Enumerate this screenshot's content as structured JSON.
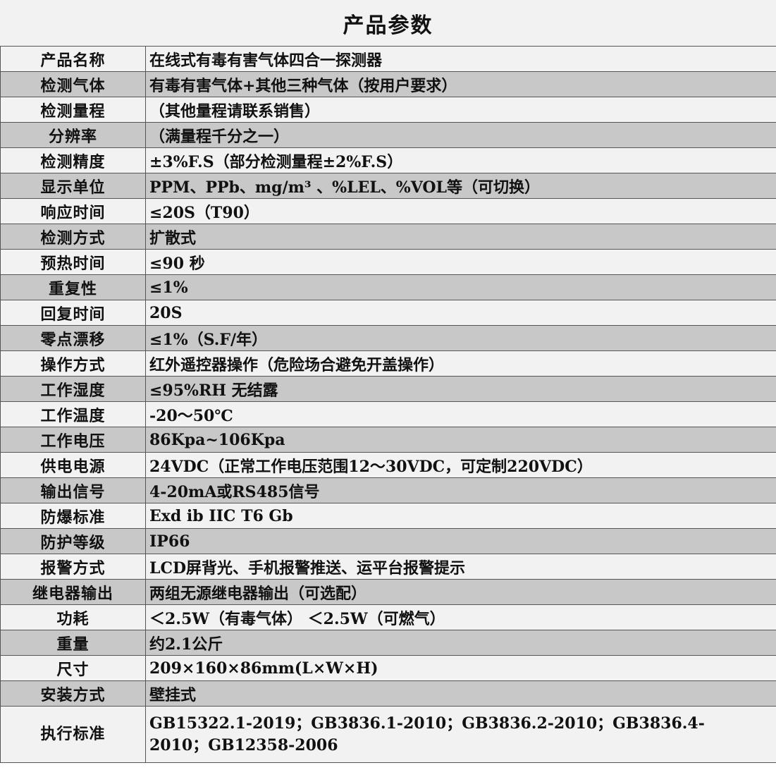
{
  "title": "产品参数",
  "rows": [
    {
      "label": "产品名称",
      "value": "在线式有毒有害气体四合一探测器"
    },
    {
      "label": "检测气体",
      "value": "有毒有害气体+其他三种气体（按用户要求）"
    },
    {
      "label": "检测量程",
      "value": "（其他量程请联系销售）"
    },
    {
      "label": "分辨率",
      "value": "（满量程千分之一）"
    },
    {
      "label": "检测精度",
      "value": "±3%F.S（部分检测量程±2%F.S）"
    },
    {
      "label": "显示单位",
      "value": "PPM、PPb、mg/m³ 、%LEL、%VOL等（可切换）"
    },
    {
      "label": "响应时间",
      "value": "≤20S（T90）"
    },
    {
      "label": "检测方式",
      "value": "扩散式"
    },
    {
      "label": "预热时间",
      "value": "≤90 秒"
    },
    {
      "label": "重复性",
      "value": "≤1%"
    },
    {
      "label": "回复时间",
      "value": "20S"
    },
    {
      "label": "零点漂移",
      "value": "≤1%（S.F/年）"
    },
    {
      "label": "操作方式",
      "value": "红外遥控器操作（危险场合避免开盖操作）"
    },
    {
      "label": "工作湿度",
      "value": "≤95%RH 无结露"
    },
    {
      "label": "工作温度",
      "value": " -20～50℃"
    },
    {
      "label": "工作电压",
      "value": "86Kpa~106Kpa"
    },
    {
      "label": "供电电源",
      "value": "24VDC（正常工作电压范围12～30VDC，可定制220VDC）"
    },
    {
      "label": "输出信号",
      "value": "4-20mA或RS485信号"
    },
    {
      "label": "防爆标准",
      "value": "Exd ib IIC T6 Gb"
    },
    {
      "label": "防护等级",
      "value": "IP66"
    },
    {
      "label": "报警方式",
      "value": "LCD屏背光、手机报警推送、运平台报警提示"
    },
    {
      "label": "继电器输出",
      "value": "两组无源继电器输出（可选配）"
    },
    {
      "label": "功耗",
      "value": "＜2.5W（有毒气体）  ＜2.5W（可燃气）"
    },
    {
      "label": "重量",
      "value": "约2.1公斤"
    },
    {
      "label": "尺寸",
      "value": "209×160×86mm(L×W×H)"
    },
    {
      "label": "安装方式",
      "value": "壁挂式"
    },
    {
      "label": "执行标准",
      "value": "GB15322.1-2019；GB3836.1-2010；GB3836.2-2010；GB3836.4-2010；GB12358-2006"
    }
  ]
}
